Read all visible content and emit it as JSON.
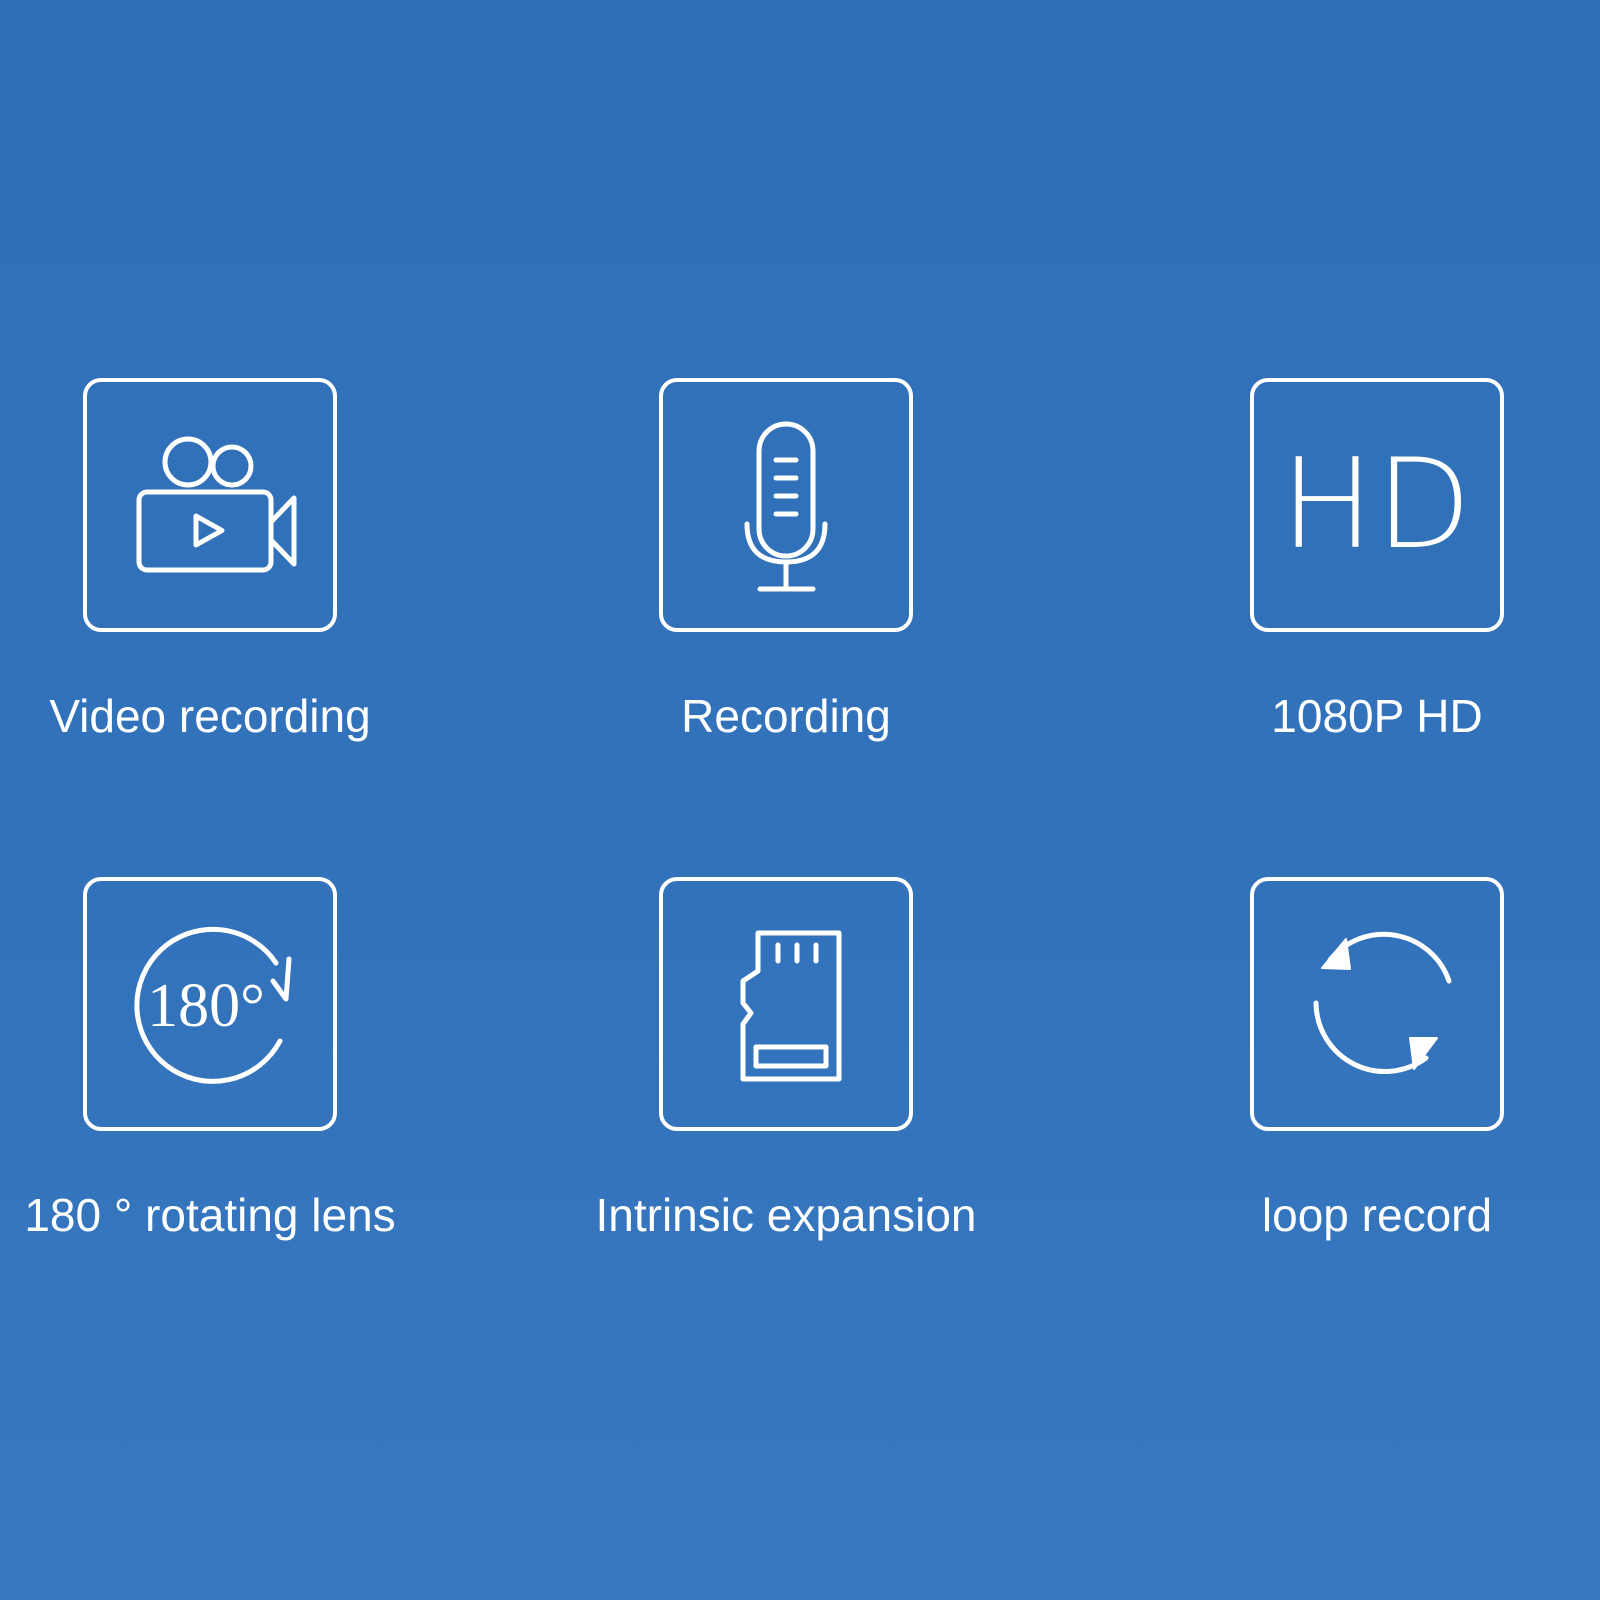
{
  "features": [
    {
      "label": "Video recording",
      "icon": "video-camera-icon"
    },
    {
      "label": "Recording",
      "icon": "microphone-icon"
    },
    {
      "label": "1080P HD",
      "icon": "hd-icon",
      "icon_text": "HD"
    },
    {
      "label": "180 ° rotating lens",
      "icon": "rotation-180-icon",
      "icon_text": "180°"
    },
    {
      "label": "Intrinsic expansion",
      "icon": "memory-card-icon"
    },
    {
      "label": "loop record",
      "icon": "loop-arrows-icon"
    }
  ],
  "colors": {
    "background": "#3272bb",
    "foreground": "#ffffff"
  }
}
